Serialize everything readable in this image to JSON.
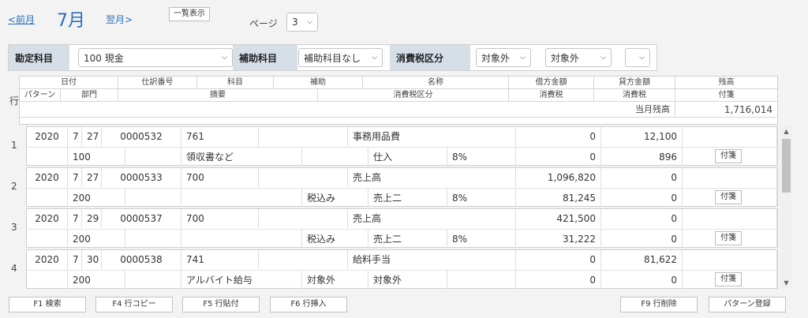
{
  "nav": {
    "prev_label": "<前月",
    "month": "7月",
    "next_label": "翌月>",
    "list_view_label": "一覧表示",
    "page_label": "ページ",
    "page_value": "3"
  },
  "filters": {
    "account_label": "勘定科目",
    "account_value": "100 現金",
    "sub_account_label": "補助科目",
    "sub_account_value": "補助科目なし",
    "tax_label": "消費税区分",
    "tax_value_1": "対象外",
    "tax_value_2": "対象外",
    "tax_value_3": ""
  },
  "header": {
    "row_label": "行",
    "top": [
      "日付",
      "仕訳番号",
      "科目",
      "補助",
      "名称",
      "借方金額",
      "貸方金額",
      "残高"
    ],
    "middle": [
      "パターン",
      "部門",
      "摘要",
      "消費税区分",
      "消費税",
      "消費税",
      "付箋"
    ],
    "balance_label": "当月残高",
    "balance_value": "1,716,014"
  },
  "entries": [
    {
      "row": "1",
      "year": "2020",
      "month": "7",
      "day": "27",
      "number": "0000532",
      "account": "761",
      "sub": "",
      "name": "事務用品費",
      "debit": "0",
      "credit": "12,100",
      "balance": "",
      "pattern": "",
      "dept": "100",
      "memo": "領収書など",
      "tax_mode": "",
      "tax_class": "仕入",
      "rate": "8%",
      "debit_tax": "0",
      "credit_tax": "896",
      "tag": "付箋"
    },
    {
      "row": "2",
      "year": "2020",
      "month": "7",
      "day": "27",
      "number": "0000533",
      "account": "700",
      "sub": "",
      "name": "売上高",
      "debit": "1,096,820",
      "credit": "0",
      "balance": "",
      "pattern": "",
      "dept": "200",
      "memo": "",
      "tax_mode": "税込み",
      "tax_class": "売上二",
      "rate": "8%",
      "debit_tax": "81,245",
      "credit_tax": "0",
      "tag": "付箋"
    },
    {
      "row": "3",
      "year": "2020",
      "month": "7",
      "day": "29",
      "number": "0000537",
      "account": "700",
      "sub": "",
      "name": "売上高",
      "debit": "421,500",
      "credit": "0",
      "balance": "",
      "pattern": "",
      "dept": "200",
      "memo": "",
      "tax_mode": "税込み",
      "tax_class": "売上二",
      "rate": "8%",
      "debit_tax": "31,222",
      "credit_tax": "0",
      "tag": "付箋"
    },
    {
      "row": "4",
      "year": "2020",
      "month": "7",
      "day": "30",
      "number": "0000538",
      "account": "741",
      "sub": "",
      "name": "給料手当",
      "debit": "0",
      "credit": "81,622",
      "balance": "",
      "pattern": "",
      "dept": "200",
      "memo": "アルバイト給与",
      "tax_mode": "対象外",
      "tax_class": "対象外",
      "rate": "",
      "debit_tax": "0",
      "credit_tax": "0",
      "tag": "付箋"
    }
  ],
  "footer": {
    "f1": "F1 検索",
    "f4": "F4 行コピー",
    "f5": "F5 行貼付",
    "f6": "F6 行挿入",
    "f9": "F9 行削除",
    "pattern": "パターン登録"
  },
  "colors": {
    "accent": "#2a6ebb",
    "label_bg": "#d6dee8"
  }
}
